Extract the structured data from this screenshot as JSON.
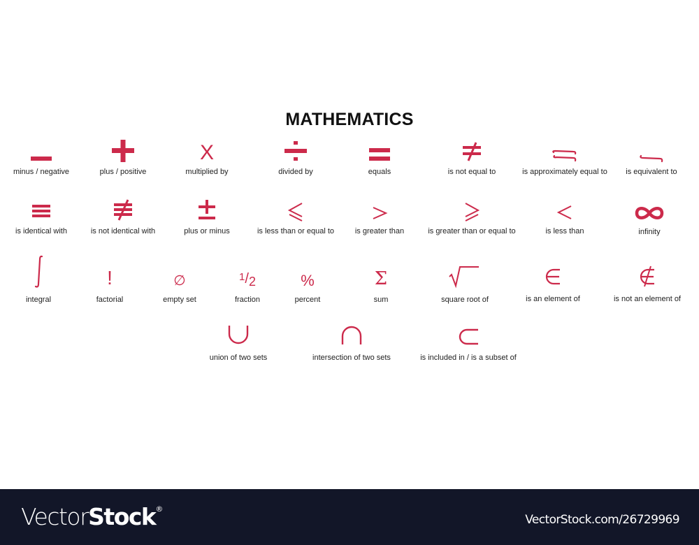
{
  "title": "MATHEMATICS",
  "accent_color": "#cc2a4b",
  "symbols": [
    {
      "name": "minus",
      "label": "minus / negative"
    },
    {
      "name": "plus",
      "label": "plus / positive"
    },
    {
      "name": "multiply",
      "label": "multiplied by"
    },
    {
      "name": "divide",
      "label": "divided by"
    },
    {
      "name": "equals",
      "label": "equals"
    },
    {
      "name": "not-equal",
      "label": "is not equal to"
    },
    {
      "name": "approx-equal",
      "label": "is approximately equal to"
    },
    {
      "name": "equivalent",
      "label": "is equivalent to"
    },
    {
      "name": "identical",
      "label": "is identical with"
    },
    {
      "name": "not-identical",
      "label": "is not identical with"
    },
    {
      "name": "plus-minus",
      "label": "plus or minus"
    },
    {
      "name": "less-equal",
      "label": "is less than or equal to"
    },
    {
      "name": "greater",
      "label": "is greater than"
    },
    {
      "name": "greater-equal",
      "label": "is greater than or equal to"
    },
    {
      "name": "less",
      "label": "is less than"
    },
    {
      "name": "infinity",
      "label": "infinity"
    },
    {
      "name": "integral",
      "label": "integral"
    },
    {
      "name": "factorial",
      "label": "factorial"
    },
    {
      "name": "empty-set",
      "label": "empty set"
    },
    {
      "name": "fraction",
      "label": "fraction"
    },
    {
      "name": "percent",
      "label": "percent"
    },
    {
      "name": "sum",
      "label": "sum"
    },
    {
      "name": "square-root",
      "label": "square root of"
    },
    {
      "name": "element-of",
      "label": "is an element of"
    },
    {
      "name": "not-element-of",
      "label": "is not an element of"
    },
    {
      "name": "union",
      "label": "union of two sets"
    },
    {
      "name": "intersection",
      "label": "intersection of two sets"
    },
    {
      "name": "subset",
      "label": "is included in / is a subset of"
    }
  ],
  "glyphs": {
    "multiply": "X",
    "factorial": "!",
    "empty_set": "∅",
    "fraction_num": "1",
    "fraction_slash": "/",
    "fraction_den": "2",
    "percent": "%",
    "sum": "Σ"
  },
  "footer": {
    "logo_light": "Vector",
    "logo_bold": "Stock",
    "logo_mark": "®",
    "url": "VectorStock.com/26729969"
  }
}
